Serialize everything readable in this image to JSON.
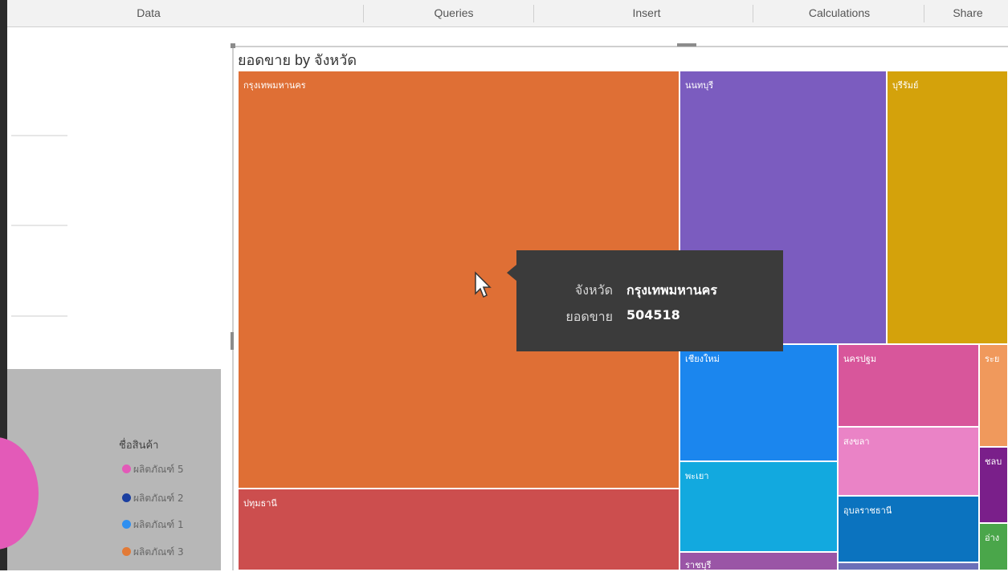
{
  "ribbon": {
    "tabs": [
      "Data",
      "Queries",
      "Insert",
      "Calculations",
      "Share"
    ]
  },
  "visual": {
    "title": "ยอดขาย by จังหวัด"
  },
  "legend": {
    "title": "ชื่อสินค้า",
    "items": [
      {
        "label": "ผลิตภัณฑ์ 5",
        "color": "#e35ab8"
      },
      {
        "label": "ผลิตภัณฑ์ 2",
        "color": "#1b3fa0"
      },
      {
        "label": "ผลิตภัณฑ์ 1",
        "color": "#2f8ff0"
      },
      {
        "label": "ผลิตภัณฑ์ 3",
        "color": "#e27a36"
      }
    ]
  },
  "treemap": {
    "tiles": [
      {
        "label": "กรุงเทพมหานคร",
        "color": "#df6f35"
      },
      {
        "label": "ปทุมธานี",
        "color": "#cc4e4e"
      },
      {
        "label": "นนทบุรี",
        "color": "#7b5cbf"
      },
      {
        "label": "บุรีรัมย์",
        "color": "#d4a20b"
      },
      {
        "label": "เชียงใหม่",
        "color": "#1b86ee"
      },
      {
        "label": "พะเยา",
        "color": "#12a9df"
      },
      {
        "label": "ราชบุรี",
        "color": "#9a55a6"
      },
      {
        "label": "นครปฐม",
        "color": "#d8569b"
      },
      {
        "label": "สงขลา",
        "color": "#ea83c6"
      },
      {
        "label": "อุบลราชธานี",
        "color": "#0b73bf"
      },
      {
        "label": "",
        "color": "#6b6fb8"
      },
      {
        "label": "ระย",
        "color": "#f0995c"
      },
      {
        "label": "ชลบ",
        "color": "#7a1f8a"
      },
      {
        "label": "อ่าง",
        "color": "#4aa64a"
      }
    ]
  },
  "tooltip": {
    "key1": "จังหวัด",
    "val1": "กรุงเทพมหานคร",
    "key2": "ยอดขาย",
    "val2": "504518"
  }
}
